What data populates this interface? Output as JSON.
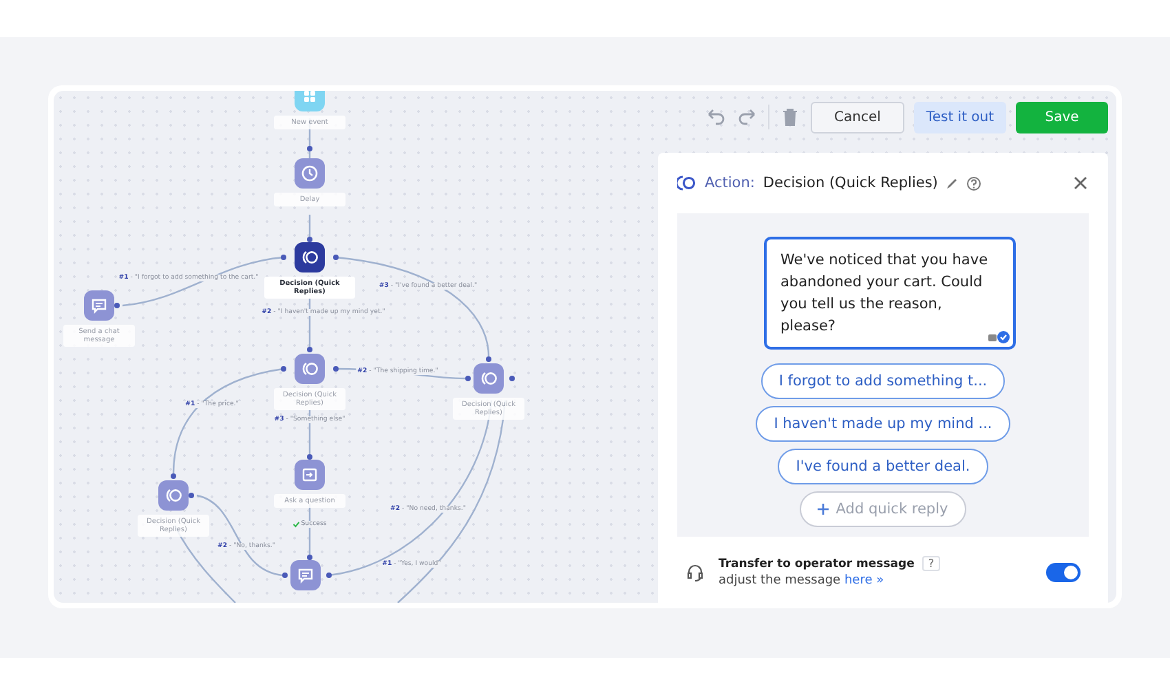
{
  "toolbar": {
    "buttons": [
      {
        "label": "Cancel",
        "kind": "secondary"
      },
      {
        "label": "Test it out",
        "kind": "tinted"
      },
      {
        "label": "Save",
        "kind": "primary"
      }
    ]
  },
  "canvas": {
    "nodes": [
      {
        "kind": "event",
        "label": "New event",
        "selected": false
      },
      {
        "kind": "delay",
        "label": "Delay",
        "selected": false
      },
      {
        "kind": "decision",
        "label": "Decision (Quick Replies)",
        "selected": true
      },
      {
        "kind": "chat",
        "label": "Send a chat message",
        "selected": false
      },
      {
        "kind": "decision",
        "label": "Decision (Quick Replies)",
        "selected": false
      },
      {
        "kind": "decision",
        "label": "Decision (Quick Replies)",
        "selected": false
      },
      {
        "kind": "question",
        "label": "Ask a question",
        "selected": false
      },
      {
        "kind": "decision",
        "label": "Decision (Quick Replies)",
        "selected": false
      },
      {
        "kind": "chat",
        "selected": false
      }
    ],
    "edge_labels": [
      {
        "kind": "choice",
        "text": "**#1** - \"I forgot to add something to the cart.\""
      },
      {
        "kind": "choice",
        "text": "**#2** - \"I haven't made up my mind yet.\""
      },
      {
        "kind": "choice",
        "text": "**#3** - \"I've found a better deal.\""
      },
      {
        "kind": "choice",
        "text": "**#2** - \"The shipping time.\""
      },
      {
        "kind": "choice",
        "text": "**#3** - \"Something else\""
      },
      {
        "kind": "choice",
        "text": "**#1** - \"The price.\""
      },
      {
        "kind": "choice",
        "text": "**#2** - \"No, thanks.\""
      },
      {
        "kind": "success",
        "text": "Success"
      },
      {
        "kind": "choice",
        "text": "**#2** - \"No need, thanks.\""
      },
      {
        "kind": "choice",
        "text": "**#1** - \"Yes, I would\""
      }
    ]
  },
  "panel": {
    "title_prefix": "Action:",
    "title": "Decision (Quick Replies)",
    "message": "We've noticed that you have abandoned your cart. Could you tell us the reason, please?",
    "quick_replies": [
      "I forgot to add something t...",
      "I haven't made up my mind ...",
      "I've found a better deal."
    ],
    "add_reply": "Add quick reply",
    "transfer": {
      "title": "Transfer to operator message",
      "help": "?",
      "hint": "adjust the message",
      "link": "here »",
      "on": true
    }
  }
}
